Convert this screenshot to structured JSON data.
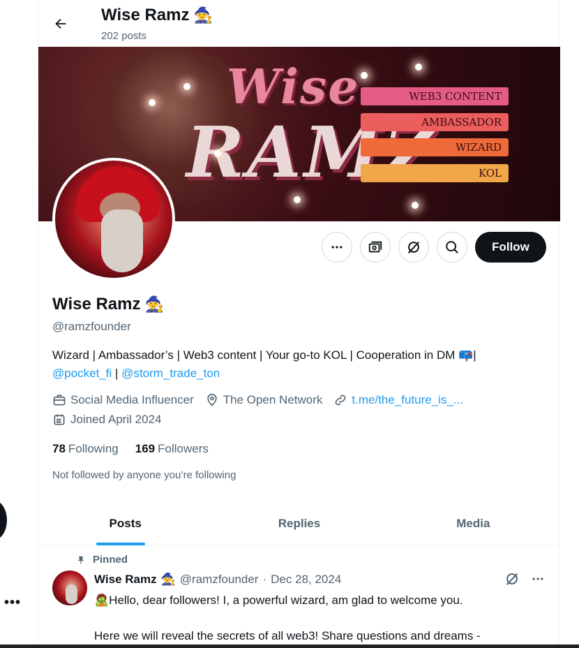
{
  "header": {
    "back_label": "←",
    "name": "Wise Ramz",
    "name_emoji": "🧙",
    "post_count": "202 posts"
  },
  "banner": {
    "title_line1": "Wise",
    "title_line2": "RAMZ",
    "tags": [
      "WEB3 CONTENT",
      "AMBASSADOR",
      "WIZARD",
      "KOL"
    ],
    "tag_colors": [
      "#e45c86",
      "#ec5d5d",
      "#ef6a39",
      "#f2a64a"
    ]
  },
  "actions": {
    "more_icon": "more-icon",
    "subscribe_icon": "money-icon",
    "grok_icon": "grok-icon",
    "search_icon": "search-icon",
    "follow_label": "Follow"
  },
  "profile": {
    "name": "Wise Ramz",
    "name_emoji": "🧙",
    "handle": "@ramzfounder",
    "bio_text": "Wizard | Ambassador’s | Web3 content | Your go-to KOL | Cooperation in DM",
    "bio_emoji": "📪",
    "bio_sep": "|",
    "mention1": "@pocket_fi",
    "mention_sep": " | ",
    "mention2": "@storm_trade_ton",
    "category": "Social Media Influencer",
    "location": "The Open Network",
    "website": "t.me/the_future_is_...",
    "joined": "Joined April 2024",
    "following_count": "78",
    "following_label": "Following",
    "followers_count": "169",
    "followers_label": "Followers",
    "not_followed_note": "Not followed by anyone you’re following"
  },
  "tabs": [
    {
      "label": "Posts",
      "active": true
    },
    {
      "label": "Replies",
      "active": false
    },
    {
      "label": "Media",
      "active": false
    }
  ],
  "pinned_post": {
    "pinned_label": "Pinned",
    "author_name": "Wise Ramz",
    "author_emoji": "🧙",
    "handle": "@ramzfounder",
    "separator": "·",
    "date": "Dec 28, 2024",
    "line1_emoji": "🧟",
    "line1": "Hello, dear followers! I, a powerful wizard, am glad to welcome you.",
    "line2": "Here we will reveal the secrets of all web3! Share questions and dreams -"
  },
  "colors": {
    "accent": "#1d9bf0",
    "text": "#0f1419",
    "muted": "#536471",
    "follow_bg": "#0f1419"
  }
}
